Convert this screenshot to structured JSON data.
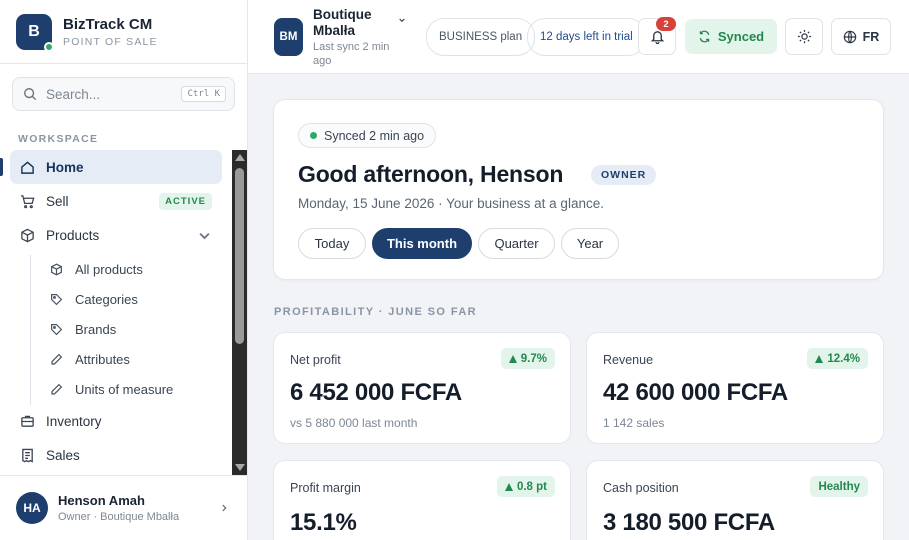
{
  "brand": {
    "logo_letter": "B",
    "name": "BizTrack CM",
    "subtitle": "POINT OF SALE"
  },
  "search": {
    "placeholder": "Search...",
    "shortcut": "Ctrl K"
  },
  "sidebar": {
    "section_label": "WORKSPACE",
    "items": [
      {
        "label": "Home",
        "icon": "home-icon",
        "active": true
      },
      {
        "label": "Sell",
        "icon": "cart-icon",
        "badge": "ACTIVE"
      },
      {
        "label": "Products",
        "icon": "box-icon",
        "expanded": true
      },
      {
        "label": "Inventory",
        "icon": "inventory-icon"
      },
      {
        "label": "Sales",
        "icon": "receipt-icon"
      }
    ],
    "product_children": [
      {
        "label": "All products",
        "icon": "box-icon"
      },
      {
        "label": "Categories",
        "icon": "tag-icon"
      },
      {
        "label": "Brands",
        "icon": "tag-icon"
      },
      {
        "label": "Attributes",
        "icon": "pencil-icon"
      },
      {
        "label": "Units of measure",
        "icon": "pencil-icon"
      }
    ]
  },
  "user": {
    "initials": "HA",
    "name": "Henson Amah",
    "role": "Owner · Boutique Mbalła"
  },
  "topbar": {
    "store_initials": "BM",
    "store_name": "Boutique Mbalła",
    "last_sync": "Last sync 2 min ago",
    "plan_label": "BUSINESS plan",
    "trial_label": "12 days left in trial",
    "notification_count": "2",
    "sync_status": "Synced",
    "language": "FR"
  },
  "greeting": {
    "sync_chip": "Synced 2 min ago",
    "title": "Good afternoon, Henson",
    "role_badge": "OWNER",
    "date_line": "Monday, 15 June 2026 · Your business at a glance.",
    "periods": [
      "Today",
      "This month",
      "Quarter",
      "Year"
    ],
    "selected_period": "This month"
  },
  "profitability": {
    "section_label": "PROFITABILITY · JUNE SO FAR",
    "cards": [
      {
        "title": "Net profit",
        "delta": "9.7%",
        "value": "6 452 000 FCFA",
        "sub": "vs 5 880 000 last month"
      },
      {
        "title": "Revenue",
        "delta": "12.4%",
        "value": "42 600 000 FCFA",
        "sub": "1 142 sales"
      },
      {
        "title": "Profit margin",
        "delta": "0.8 pt",
        "value": "15.1%"
      },
      {
        "title": "Cash position",
        "status": "Healthy",
        "value": "3 180 500 FCFA"
      }
    ]
  },
  "colors": {
    "brand": "#1e3f6e",
    "success": "#23884f",
    "success_bg": "#e3f4ea",
    "alert": "#d8403a"
  }
}
